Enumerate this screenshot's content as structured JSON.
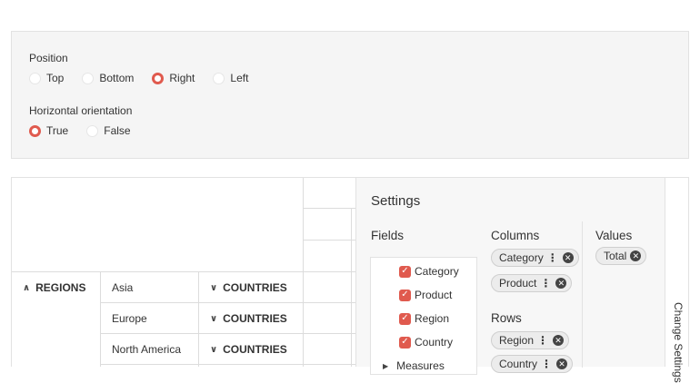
{
  "options": {
    "position": {
      "label": "Position",
      "options": [
        "Top",
        "Bottom",
        "Right",
        "Left"
      ],
      "selected": "Right"
    },
    "horizontal": {
      "label": "Horizontal orientation",
      "options": [
        "True",
        "False"
      ],
      "selected": "True"
    }
  },
  "grid": {
    "row_header": "REGIONS",
    "rows": [
      {
        "region": "Asia",
        "countries": "COUNTRIES"
      },
      {
        "region": "Europe",
        "countries": "COUNTRIES"
      },
      {
        "region": "North America",
        "countries": "COUNTRIES"
      }
    ]
  },
  "settings": {
    "title": "Settings",
    "fields_label": "Fields",
    "fields": [
      {
        "label": "Category",
        "checked": true
      },
      {
        "label": "Product",
        "checked": true
      },
      {
        "label": "Region",
        "checked": true
      },
      {
        "label": "Country",
        "checked": true
      }
    ],
    "measures_label": "Measures",
    "columns_label": "Columns",
    "columns": [
      "Category",
      "Product"
    ],
    "rows_label": "Rows",
    "rows": [
      "Region",
      "Country"
    ],
    "values_label": "Values",
    "values": [
      "Total"
    ]
  },
  "side_tab": {
    "label": "Change Settings"
  },
  "colors": {
    "accent": "#e05a4e",
    "panel_bg": "#f5f5f5"
  }
}
